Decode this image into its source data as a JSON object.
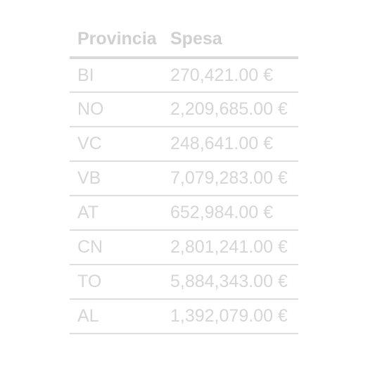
{
  "table": {
    "headers": {
      "provincia": "Provincia",
      "spesa": "Spesa"
    },
    "rows": [
      {
        "provincia": "BI",
        "spesa": "270,421.00 €"
      },
      {
        "provincia": "NO",
        "spesa": "2,209,685.00 €"
      },
      {
        "provincia": "VC",
        "spesa": "248,641.00 €"
      },
      {
        "provincia": "VB",
        "spesa": "7,079,283.00 €"
      },
      {
        "provincia": "AT",
        "spesa": "652,984.00 €"
      },
      {
        "provincia": "CN",
        "spesa": "2,801,241.00 €"
      },
      {
        "provincia": "TO",
        "spesa": "5,884,343.00 €"
      },
      {
        "provincia": "AL",
        "spesa": "1,392,079.00 €"
      }
    ]
  }
}
